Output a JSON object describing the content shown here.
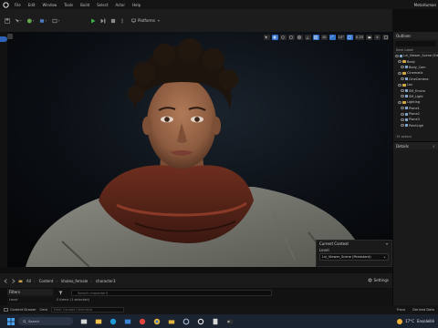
{
  "menubar": {
    "items": [
      "File",
      "Edit",
      "Window",
      "Tools",
      "Build",
      "Select",
      "Actor",
      "Help"
    ],
    "project": "MetaHuman"
  },
  "toolbar": {
    "platforms_label": "Platforms"
  },
  "viewport": {
    "tools_right": [
      "10",
      "10°",
      "0.25",
      "4"
    ],
    "accent": "#3573c9"
  },
  "current_context": {
    "title": "Current Context",
    "level_label": "Level",
    "level_value": "Lvl_Viewer_Scene (Persistent)"
  },
  "outliner": {
    "title": "Outliner",
    "column": "Item Label",
    "rows": [
      {
        "label": "Lvl_Viewer_Scene (Editor)",
        "kind": "level",
        "indent": 0
      },
      {
        "label": "Body",
        "kind": "folder",
        "indent": 1
      },
      {
        "label": "Body_Com",
        "kind": "actor",
        "indent": 2
      },
      {
        "label": "Cinematic",
        "kind": "folder",
        "indent": 1
      },
      {
        "label": "CineCamera",
        "kind": "actor",
        "indent": 2
      },
      {
        "label": "Lev",
        "kind": "folder",
        "indent": 1
      },
      {
        "label": "SM_Enviro",
        "kind": "actor",
        "indent": 2
      },
      {
        "label": "SM_Light",
        "kind": "actor",
        "indent": 2
      },
      {
        "label": "Lighting",
        "kind": "folder",
        "indent": 1
      },
      {
        "label": "Plane1",
        "kind": "actor",
        "indent": 2
      },
      {
        "label": "Plane2",
        "kind": "actor",
        "indent": 2
      },
      {
        "label": "Plane3",
        "kind": "actor",
        "indent": 2
      },
      {
        "label": "PointLigh",
        "kind": "actor",
        "indent": 2
      }
    ],
    "count": "15 actors"
  },
  "details": {
    "title": "Details"
  },
  "content_browser": {
    "breadcrumbs": [
      "All",
      "Content",
      "khaleo_female",
      "character3"
    ],
    "settings_label": "Settings",
    "filters_title": "Filters",
    "filters_item": "Level",
    "search_placeholder": "Search character3",
    "asset_count": "0 items (1 selected)"
  },
  "statusbar": {
    "drawer_label": "Content Drawer",
    "cmd_label": "Cmd",
    "cmd_placeholder": "Enter Console Command",
    "trace_label": "Trace",
    "derived_label": "Derived Data"
  },
  "taskbar": {
    "search_label": "Search",
    "temperature": "17°C",
    "weather_text": "Ensoleillé"
  }
}
